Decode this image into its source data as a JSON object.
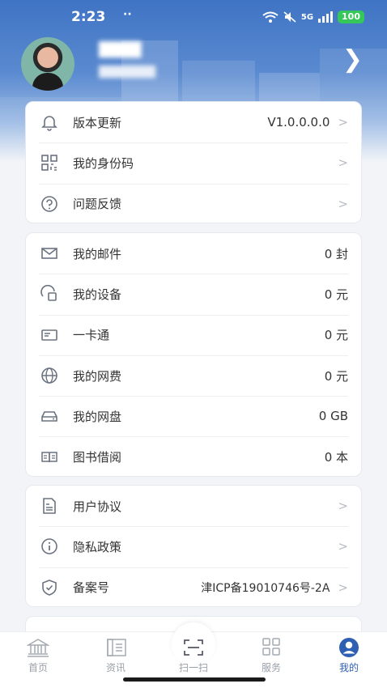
{
  "status_bar": {
    "time": "2:23",
    "dots": "··",
    "network": "5G",
    "battery": "100"
  },
  "profile": {
    "name": "████",
    "uid": "███████"
  },
  "settings_group": [
    {
      "id": "version",
      "icon": "bell-icon",
      "label": "版本更新",
      "value": "V1.0.0.0.0",
      "chevron": ">"
    },
    {
      "id": "idcode",
      "icon": "qr-code-icon",
      "label": "我的身份码",
      "value": "",
      "chevron": ">"
    },
    {
      "id": "feedback",
      "icon": "question-icon",
      "label": "问题反馈",
      "value": "",
      "chevron": ">"
    }
  ],
  "stats_group": [
    {
      "id": "mail",
      "icon": "mail-icon",
      "label": "我的邮件",
      "value": "0 封"
    },
    {
      "id": "device",
      "icon": "device-icon",
      "label": "我的设备",
      "value": "0 元"
    },
    {
      "id": "card",
      "icon": "card-icon",
      "label": "一卡通",
      "value": "0 元"
    },
    {
      "id": "netfee",
      "icon": "globe-icon",
      "label": "我的网费",
      "value": "0 元"
    },
    {
      "id": "netdisk",
      "icon": "disk-icon",
      "label": "我的网盘",
      "value": "0 GB"
    },
    {
      "id": "library",
      "icon": "book-icon",
      "label": "图书借阅",
      "value": "0 本"
    }
  ],
  "legal_group": [
    {
      "id": "agreement",
      "icon": "document-icon",
      "label": "用户协议",
      "value": "",
      "chevron": ">"
    },
    {
      "id": "privacy",
      "icon": "info-icon",
      "label": "隐私政策",
      "value": "",
      "chevron": ">"
    },
    {
      "id": "icp",
      "icon": "shield-icon",
      "label": "备案号",
      "value": "津ICP备19010746号-2A",
      "chevron": ">"
    }
  ],
  "tabs": [
    {
      "id": "home",
      "label": "首页",
      "active": false
    },
    {
      "id": "news",
      "label": "资讯",
      "active": false
    },
    {
      "id": "scan",
      "label": "扫一扫",
      "active": false
    },
    {
      "id": "service",
      "label": "服务",
      "active": false
    },
    {
      "id": "mine",
      "label": "我的",
      "active": true
    }
  ],
  "colors": {
    "accent": "#2f5fb3",
    "hero": "#3f74c4",
    "icon": "#6b7380"
  }
}
